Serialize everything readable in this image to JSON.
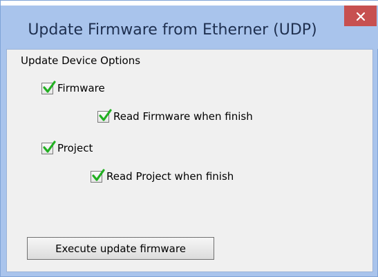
{
  "window": {
    "title": "Update Firmware from Etherner (UDP)",
    "close_glyph": "×"
  },
  "group": {
    "label": "Update Device Options"
  },
  "options": {
    "firmware": {
      "label": "Firmware",
      "checked": true
    },
    "read_firmware": {
      "label": "Read Firmware when finish",
      "checked": true
    },
    "project": {
      "label": "Project",
      "checked": true
    },
    "read_project": {
      "label": "Read Project when finish",
      "checked": true
    }
  },
  "actions": {
    "execute_label": "Execute update firmware"
  },
  "icons": {
    "close": "close-icon",
    "check": "checkmark-icon"
  },
  "colors": {
    "title_bar": "#a9c4ec",
    "close_button": "#c75050",
    "client_background": "#f0f0f0",
    "check_green": "#22b022"
  }
}
